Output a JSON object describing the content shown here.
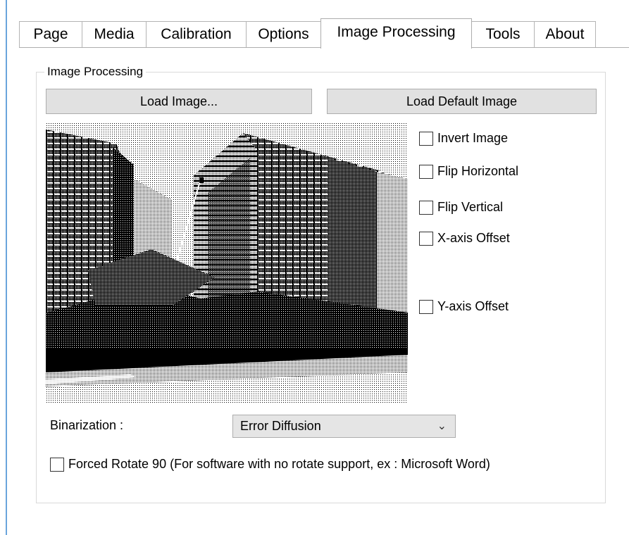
{
  "tabs": [
    {
      "label": "Page"
    },
    {
      "label": "Media"
    },
    {
      "label": "Calibration"
    },
    {
      "label": "Options"
    },
    {
      "label": "Image Processing",
      "active": true
    },
    {
      "label": "Tools"
    },
    {
      "label": "About"
    }
  ],
  "group": {
    "title": "Image Processing"
  },
  "buttons": {
    "load_image": "Load Image...",
    "load_default": "Load Default Image"
  },
  "checkboxes": {
    "invert": {
      "label": "Invert Image",
      "checked": false
    },
    "flip_h": {
      "label": "Flip Horizontal",
      "checked": false
    },
    "flip_v": {
      "label": "Flip Vertical",
      "checked": false
    },
    "x_offset": {
      "label": "X-axis Offset",
      "checked": false
    },
    "y_offset": {
      "label": "Y-axis Offset",
      "checked": false
    },
    "rotate": {
      "label": "Forced Rotate 90 (For software with no rotate support, ex : Microsoft Word)",
      "checked": false
    }
  },
  "binarization": {
    "label": "Binarization :",
    "value": "Error Diffusion"
  },
  "colors": {
    "window_edge": "#6aa5dc",
    "button_bg": "#e1e1e1",
    "select_bg": "#e5e5e5"
  }
}
